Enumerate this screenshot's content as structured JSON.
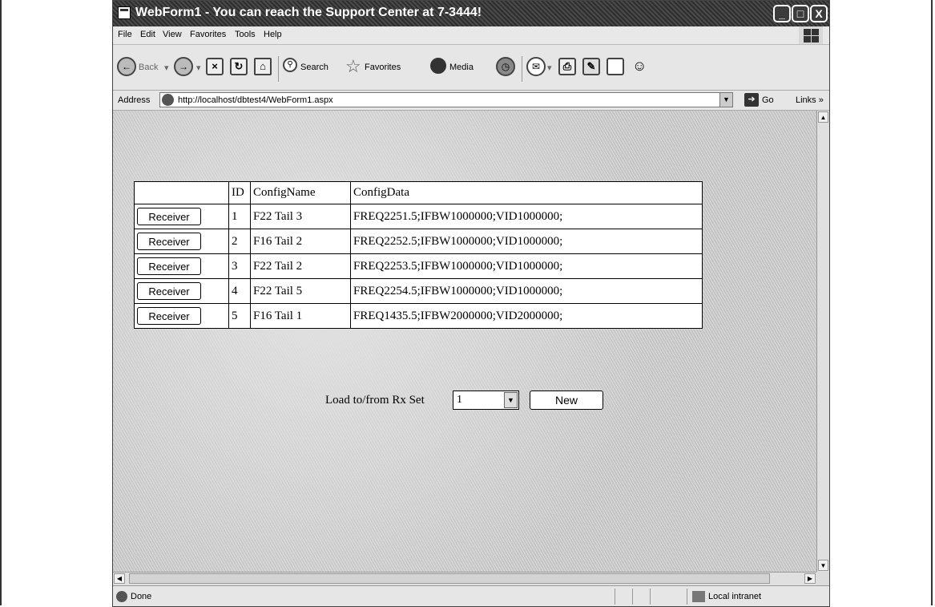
{
  "window": {
    "title": "WebForm1 - You can reach the Support Center at 7-3444!",
    "controls": {
      "minimize": "_",
      "maximize": "□",
      "close": "X"
    }
  },
  "menubar": [
    "File",
    "Edit",
    "View",
    "Favorites",
    "Tools",
    "Help"
  ],
  "toolbar": {
    "back": "Back",
    "search": "Search",
    "favorites": "Favorites",
    "media": "Media"
  },
  "address": {
    "label": "Address",
    "url": "http://localhost/dbtest4/WebForm1.aspx",
    "go": "Go",
    "links": "Links"
  },
  "grid": {
    "headers": [
      "",
      "ID",
      "ConfigName",
      "ConfigData"
    ],
    "rows": [
      {
        "button": "Receiver",
        "id": "1",
        "name": "F22 Tail 3",
        "data": "FREQ2251.5;IFBW1000000;VID1000000;"
      },
      {
        "button": "Receiver",
        "id": "2",
        "name": "F16 Tail 2",
        "data": "FREQ2252.5;IFBW1000000;VID1000000;"
      },
      {
        "button": "Receiver",
        "id": "3",
        "name": "F22 Tail 2",
        "data": "FREQ2253.5;IFBW1000000;VID1000000;"
      },
      {
        "button": "Receiver",
        "id": "4",
        "name": "F22 Tail 5",
        "data": "FREQ2254.5;IFBW1000000;VID1000000;"
      },
      {
        "button": "Receiver",
        "id": "5",
        "name": "F16 Tail 1",
        "data": "FREQ1435.5;IFBW2000000;VID2000000;"
      }
    ]
  },
  "load": {
    "label": "Load to/from Rx Set",
    "selected": "1",
    "new_button": "New"
  },
  "status": {
    "text": "Done",
    "zone": "Local intranet"
  }
}
